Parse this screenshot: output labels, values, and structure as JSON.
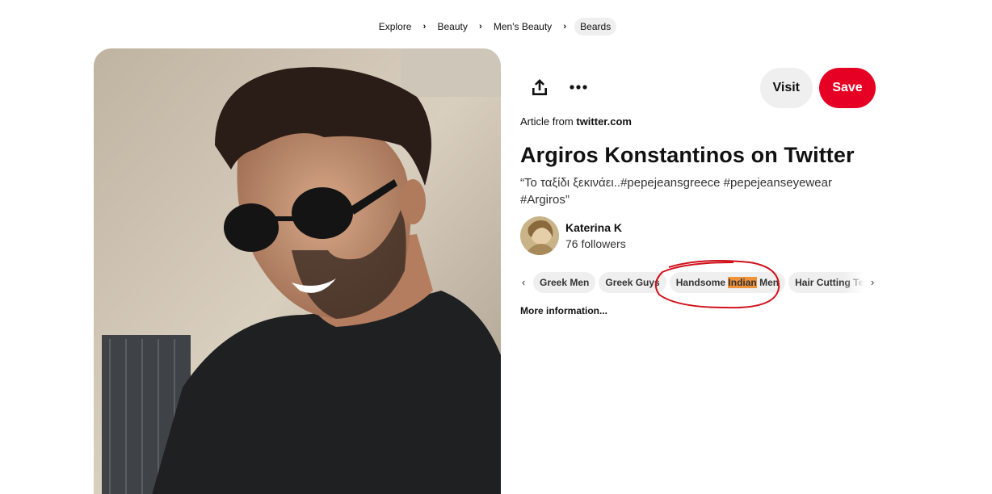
{
  "breadcrumb": {
    "items": [
      "Explore",
      "Beauty",
      "Men's Beauty"
    ],
    "current": "Beards"
  },
  "icons": {
    "breadcrumb_separator": "chevron-right-icon",
    "share": "share-upload-icon",
    "more": "ellipsis-icon",
    "tags_prev": "chevron-left-icon",
    "tags_next": "chevron-right-icon"
  },
  "colors": {
    "save": "#e60023",
    "visit": "#efefef",
    "tag_bg": "#efefef",
    "highlight": "#f0923a",
    "annotation": "#d0121b"
  },
  "actions": {
    "visit_label": "Visit",
    "save_label": "Save"
  },
  "pin": {
    "article_prefix": "Article from",
    "source": "twitter.com",
    "title": "Argiros Konstantinos on Twitter",
    "description": "“Το ταξίδι ξεκινάει..#pepejeansgreece #pepejeanseyewear #Argiros”"
  },
  "creator": {
    "name": "Katerina K",
    "followers": "76 followers"
  },
  "tags": [
    {
      "label": "Greek Men"
    },
    {
      "label": "Greek Guys"
    },
    {
      "pre": "Handsome ",
      "highlight": "Indian",
      "post": " Men"
    },
    {
      "label": "Hair Cutting Techniques"
    }
  ],
  "more_information": "More information..."
}
